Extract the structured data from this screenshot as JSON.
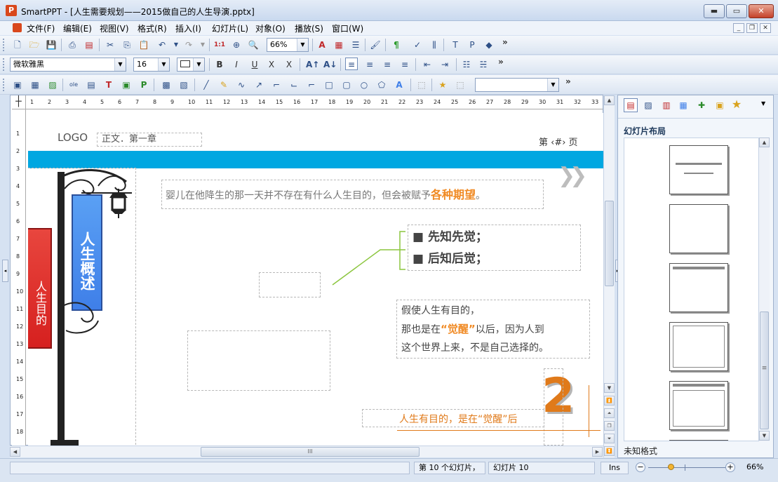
{
  "app": {
    "icon_letter": "P",
    "title": "SmartPPT - [人生需要规划——2015做自己的人生导演.pptx]"
  },
  "window_buttons": {
    "minimize": "▬",
    "maximize": "▭",
    "close": "✕"
  },
  "menu": {
    "items": [
      "文件(F)",
      "编辑(E)",
      "视图(V)",
      "格式(R)",
      "插入(I)",
      "幻灯片(L)",
      "对象(O)",
      "播放(S)",
      "窗口(W)"
    ],
    "mdi_minimize": "_",
    "mdi_restore": "❐",
    "mdi_close": "✕"
  },
  "toolbar1": {
    "zoom_value": "66%",
    "more": "»"
  },
  "toolbar2": {
    "font_name": "微软雅黑",
    "font_size": "16",
    "bold": "B",
    "italic": "I",
    "underline": "U",
    "strike": "X",
    "clear": "X",
    "more": "»"
  },
  "toolbar3": {
    "more": "»",
    "combo_value": ""
  },
  "ruler": {
    "h_ticks": [
      "1",
      "2",
      "3",
      "4",
      "5",
      "6",
      "7",
      "8",
      "9",
      "10",
      "11",
      "12",
      "13",
      "14",
      "15",
      "16",
      "17",
      "18",
      "19",
      "20",
      "21",
      "22",
      "23",
      "24",
      "25",
      "26",
      "27",
      "28",
      "29",
      "30",
      "31",
      "32",
      "33"
    ],
    "v_ticks": [
      "1",
      "2",
      "3",
      "4",
      "5",
      "6",
      "7",
      "8",
      "9",
      "10",
      "11",
      "12",
      "13",
      "14",
      "15",
      "16",
      "17",
      "18"
    ]
  },
  "slide": {
    "logo": "LOGO",
    "header_placeholder": "正文．第一章",
    "page_label": "第 ‹#› 页",
    "intro_prefix": "婴儿在他降生的那一天并不存在有什么人生目的，但会被赋予",
    "intro_highlight": "各种期望",
    "intro_suffix": "。",
    "bullets": [
      "先知先觉；",
      "后知后觉；"
    ],
    "para_line1": "假使人生有目的，",
    "para_line2_prefix": "那也是在",
    "para_line2_highlight": "“觉醒”",
    "para_line2_suffix": "以后，因为人到",
    "para_line3": "这个世界上来，不是自己选择的。",
    "bottom_line": "人生有目的，是在“觉醒”后",
    "big_number": "2",
    "banner_blue": "人生概述",
    "banner_red": "人生目的",
    "colors": {
      "accent_blue": "#00a7e1",
      "orange": "#f08a24",
      "bottom_orange": "#e07a1a",
      "banner_blue": "#3f7fe8",
      "banner_red": "#d6201f"
    }
  },
  "right_panel": {
    "title": "幻灯片布局",
    "footer": "未知格式"
  },
  "status": {
    "slide_count": "第 10 个幻灯片，",
    "slide_name": "幻灯片 10",
    "ins": "Ins",
    "zoom": "66%",
    "zoom_minus": "−",
    "zoom_plus": "+"
  },
  "scroll": {
    "hscroll_grip": "III",
    "vscroll_grip": "≡"
  }
}
